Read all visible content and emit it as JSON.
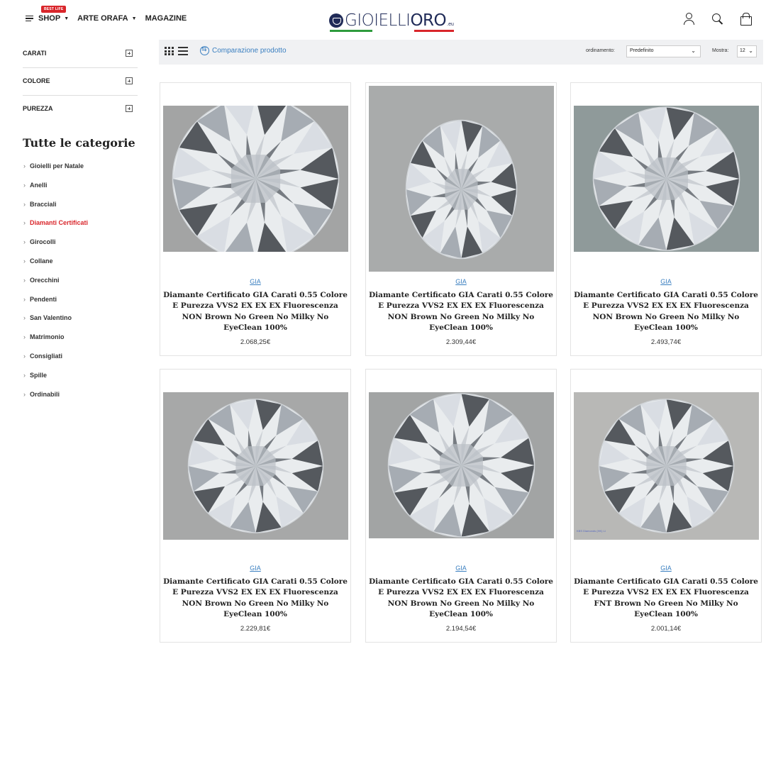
{
  "header": {
    "nav": [
      {
        "label": "SHOP",
        "badge": "BEST LIFE",
        "has_caret": true
      },
      {
        "label": "ARTE ORAFA",
        "has_caret": true
      },
      {
        "label": "MAGAZINE",
        "has_caret": false
      }
    ],
    "logo": {
      "part1": "GIOIELLI",
      "part2": "ORO",
      "suffix": ".eu"
    },
    "icons": [
      "user-icon",
      "search-icon",
      "bag-icon"
    ]
  },
  "toolbar": {
    "compare_label": "Comparazione prodotto",
    "sort_label": "ordinamento:",
    "sort_value": "Predefinito",
    "show_label": "Mostra:",
    "show_value": "12"
  },
  "filters": [
    "CARATI",
    "COLORE",
    "PUREZZA"
  ],
  "categories": {
    "title": "Tutte le categorie",
    "items": [
      {
        "label": "Gioielli per Natale",
        "active": false
      },
      {
        "label": "Anelli",
        "active": false
      },
      {
        "label": "Bracciali",
        "active": false
      },
      {
        "label": "Diamanti Certificati",
        "active": true
      },
      {
        "label": "Girocolli",
        "active": false
      },
      {
        "label": "Collane",
        "active": false
      },
      {
        "label": "Orecchini",
        "active": false
      },
      {
        "label": "Pendenti",
        "active": false
      },
      {
        "label": "San Valentino",
        "active": false
      },
      {
        "label": "Matrimonio",
        "active": false
      },
      {
        "label": "Consigliati",
        "active": false
      },
      {
        "label": "Spille",
        "active": false
      },
      {
        "label": "Ordinabili",
        "active": false
      }
    ]
  },
  "products": [
    {
      "brand": "GIA",
      "title": "Diamante Certificato GIA Carati 0.55 Colore E Purezza VVS2 EX EX EX Fluorescenza NON Brown No Green No Milky No EyeClean 100%",
      "price": "2.068,25€"
    },
    {
      "brand": "GIA",
      "title": "Diamante Certificato GIA Carati 0.55 Colore E Purezza VVS2 EX EX EX Fluorescenza NON Brown No Green No Milky No EyeClean 100%",
      "price": "2.309,44€"
    },
    {
      "brand": "GIA",
      "title": "Diamante Certificato GIA Carati 0.55 Colore E Purezza VVS2 EX EX EX Fluorescenza NON Brown No Green No Milky No EyeClean 100%",
      "price": "2.493,74€"
    },
    {
      "brand": "GIA",
      "title": "Diamante Certificato GIA Carati 0.55 Colore E Purezza VVS2 EX EX EX Fluorescenza NON Brown No Green No Milky No EyeClean 100%",
      "price": "2.229,81€"
    },
    {
      "brand": "GIA",
      "title": "Diamante Certificato GIA Carati 0.55 Colore E Purezza VVS2 EX EX EX Fluorescenza NON Brown No Green No Milky No EyeClean 100%",
      "price": "2.194,54€"
    },
    {
      "brand": "GIA",
      "title": "Diamante Certificato GIA Carati 0.55 Colore E Purezza VVS2 EX EX EX Fluorescenza FNT Brown No Green No Milky No EyeClean 100%",
      "price": "2.001,14€",
      "watermark": "KBS Diamonds (HK) Li"
    }
  ],
  "colors": {
    "accent_red": "#d9262b",
    "link_blue": "#3a7fc0",
    "brand_navy": "#1f2a57",
    "flag_green": "#2e9b3d"
  }
}
